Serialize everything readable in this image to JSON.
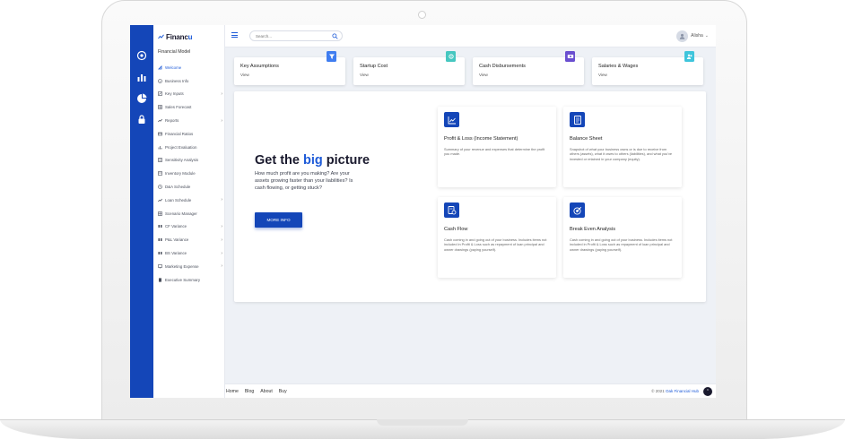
{
  "app": {
    "logo_text": "Financ",
    "logo_accent": "u",
    "section_title": "Financial Model"
  },
  "sidebar": {
    "items": [
      {
        "label": "Welcome",
        "icon": "rocket-icon",
        "chevron": false,
        "active": true
      },
      {
        "label": "Business Info",
        "icon": "info-icon",
        "chevron": false,
        "active": false
      },
      {
        "label": "Key Inputs",
        "icon": "edit-icon",
        "chevron": true,
        "active": false
      },
      {
        "label": "Sales Forecast",
        "icon": "grid-icon",
        "chevron": false,
        "active": false
      },
      {
        "label": "Reports",
        "icon": "trend-icon",
        "chevron": true,
        "active": false
      },
      {
        "label": "Financial Ratios",
        "icon": "card-icon",
        "chevron": false,
        "active": false
      },
      {
        "label": "Project Evaluation",
        "icon": "bar-chart-icon",
        "chevron": false,
        "active": false
      },
      {
        "label": "Sensitivity Analysis",
        "icon": "list-icon",
        "chevron": false,
        "active": false
      },
      {
        "label": "Inventory Module",
        "icon": "box-icon",
        "chevron": false,
        "active": false
      },
      {
        "label": "D&A Schedule",
        "icon": "clock-icon",
        "chevron": false,
        "active": false
      },
      {
        "label": "Loan Schedule",
        "icon": "trend-icon",
        "chevron": true,
        "active": false
      },
      {
        "label": "Scenario Manager",
        "icon": "grid-icon",
        "chevron": false,
        "active": false
      },
      {
        "label": "CF Variance",
        "icon": "columns-icon",
        "chevron": true,
        "active": false
      },
      {
        "label": "P&L Variance",
        "icon": "columns-icon",
        "chevron": true,
        "active": false
      },
      {
        "label": "BS Variance",
        "icon": "columns-icon",
        "chevron": true,
        "active": false
      },
      {
        "label": "Marketing Expense",
        "icon": "monitor-icon",
        "chevron": true,
        "active": false
      },
      {
        "label": "Executive Summary",
        "icon": "doc-icon",
        "chevron": false,
        "active": false
      }
    ],
    "chevron_glyph": "›"
  },
  "topbar": {
    "search_placeholder": "Search...",
    "user_name": "Alisha",
    "user_chevron": "⌄"
  },
  "key_cards": [
    {
      "title": "Key Assumptions",
      "link": "View",
      "badge_color": "#3f7df0",
      "icon": "filter-icon"
    },
    {
      "title": "Startup Cost",
      "link": "View",
      "badge_color": "#46c7c0",
      "icon": "tag-icon"
    },
    {
      "title": "Cash Disbursements",
      "link": "View",
      "badge_color": "#6a4fd0",
      "icon": "money-icon"
    },
    {
      "title": "Salaries & Wages",
      "link": "View",
      "badge_color": "#3fc5dc",
      "icon": "people-icon"
    }
  ],
  "hero": {
    "title_before": "Get the ",
    "title_accent": "big",
    "title_after": " picture",
    "description": "How much profit are you making? Are your assets growing faster than your liabilities? Is cash flowing, or getting stuck?",
    "button_label": "MORE INFO"
  },
  "feature_cards": [
    {
      "title": "Profit & Loss (Income Statement)",
      "desc": "Summary of your revenue and expenses that determine the profit you made.",
      "icon": "line-chart-icon"
    },
    {
      "title": "Balance Sheet",
      "desc": "Snapshot of what your business owns or is due to receive from others (assets), what it owes to others (liabilities), and what you've invested or retained in your company (equity).",
      "icon": "document-icon"
    },
    {
      "title": "Cash Flow",
      "desc": "Cash coming in and going out of your business. Includes items not included in Profit & Loss such as repayment of loan principal and owner drawings (paying yourself).",
      "icon": "cash-icon"
    },
    {
      "title": "Break Even Analysis",
      "desc": "Cash coming in and going out of your business. Includes items not included in Profit & Loss such as repayment of loan principal and owner drawings (paying yourself).",
      "icon": "target-icon"
    }
  ],
  "footer": {
    "links": [
      "Home",
      "Blog",
      "About",
      "Buy"
    ],
    "copy_prefix": "© 2021 ",
    "copy_brand": "Oak Financial Hub",
    "to_top_glyph": "⌃"
  },
  "colors": {
    "primary": "#1446b8",
    "accent": "#1e5bd8"
  }
}
